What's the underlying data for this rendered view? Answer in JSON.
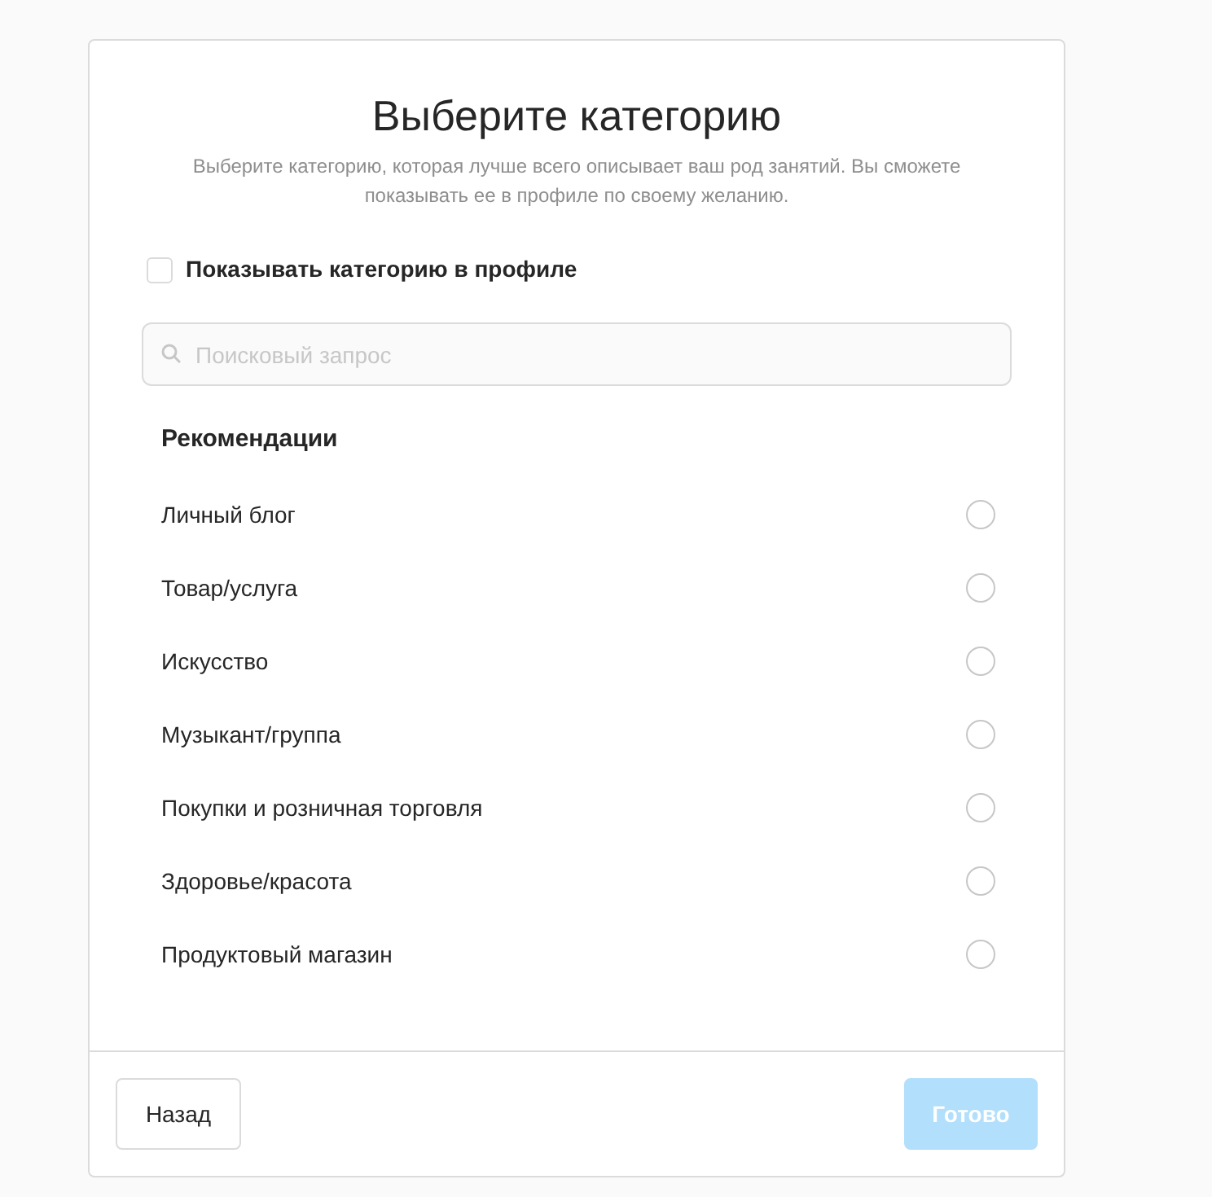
{
  "dialog": {
    "title": "Выберите категорию",
    "description": "Выберите категорию, которая лучше всего описывает ваш род занятий. Вы сможете показывать ее в профиле по своему желанию."
  },
  "show_in_profile": {
    "label": "Показывать категорию в профиле",
    "checked": false
  },
  "search": {
    "placeholder": "Поисковый запрос"
  },
  "section_title": "Рекомендации",
  "categories": [
    {
      "label": "Личный блог",
      "selected": false
    },
    {
      "label": "Товар/услуга",
      "selected": false
    },
    {
      "label": "Искусство",
      "selected": false
    },
    {
      "label": "Музыкант/группа",
      "selected": false
    },
    {
      "label": "Покупки и розничная торговля",
      "selected": false
    },
    {
      "label": "Здоровье/красота",
      "selected": false
    },
    {
      "label": "Продуктовый магазин",
      "selected": false
    }
  ],
  "buttons": {
    "back": {
      "label": "Назад"
    },
    "done": {
      "label": "Готово",
      "disabled": true
    }
  }
}
